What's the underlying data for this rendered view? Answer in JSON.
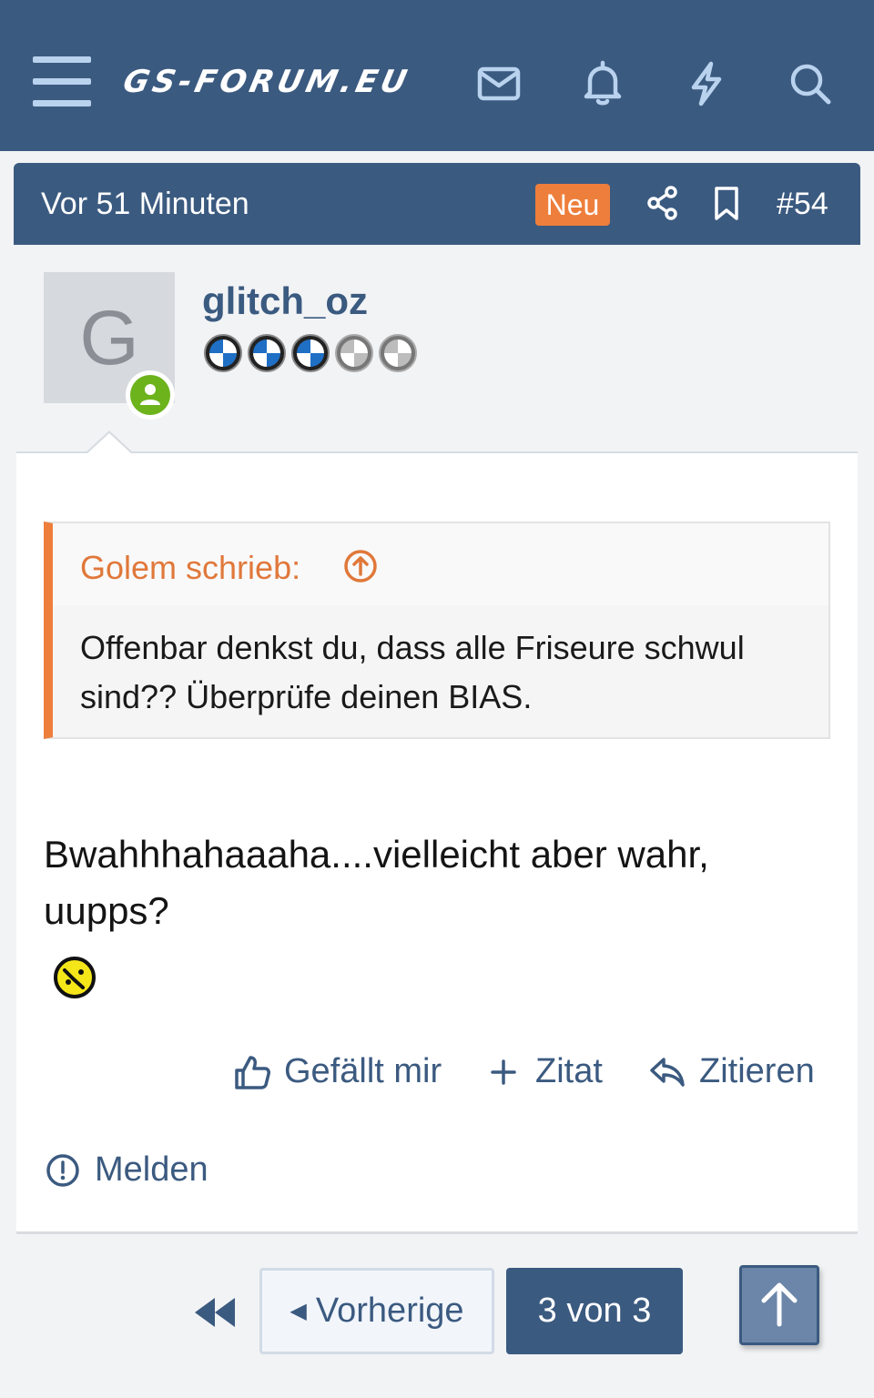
{
  "header": {
    "logo_text": "GS-FORUM.EU",
    "icons": [
      "menu-icon",
      "envelope-icon",
      "bell-icon",
      "bolt-icon",
      "search-icon"
    ]
  },
  "post": {
    "time": "Vor 51 Minuten",
    "new_badge": "Neu",
    "number": "#54",
    "user": {
      "avatar_letter": "G",
      "name": "glitch_oz",
      "rank_filled": 3,
      "rank_total": 5,
      "online": true
    },
    "quote": {
      "author": "Golem schrieb:",
      "text": "Offenbar denkst du, dass alle Friseure schwul sind?? Überprüfe deinen BIAS."
    },
    "message": "Bwahhhahaaaha....vielleicht aber wahr, uupps?",
    "actions": {
      "like": "Gefällt mir",
      "add_quote": "Zitat",
      "reply": "Zitieren",
      "report": "Melden"
    }
  },
  "pagination": {
    "prev_label": "Vorherige",
    "current": "3 von 3"
  },
  "colors": {
    "primary": "#3b5a80",
    "accent": "#ee7e3b",
    "online": "#6cb31c"
  }
}
